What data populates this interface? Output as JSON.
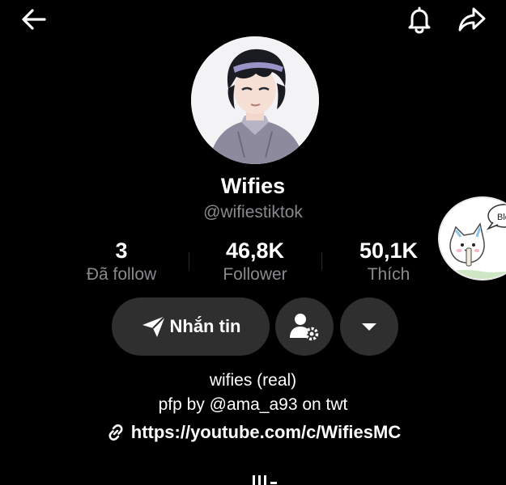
{
  "profile": {
    "display_name": "Wifies",
    "username": "@wifiestiktok"
  },
  "stats": {
    "following": {
      "value": "3",
      "label": "Đã follow"
    },
    "followers": {
      "value": "46,8K",
      "label": "Follower"
    },
    "likes": {
      "value": "50,1K",
      "label": "Thích"
    }
  },
  "actions": {
    "message_label": "Nhắn tin"
  },
  "bio": {
    "line1": "wifies (real)",
    "line2": "pfp by @ama_a93 on twt",
    "link": "https://youtube.com/c/WifiesMC"
  },
  "side_avatar": {
    "speech_text": "Ble"
  },
  "icons": {
    "back": "back-arrow-icon",
    "notifications": "bell-icon",
    "share": "share-arrow-icon",
    "send": "send-icon",
    "add_friend": "user-settings-icon",
    "more": "caret-down-icon",
    "link": "link-icon"
  },
  "colors": {
    "background": "#000000",
    "text_primary": "#ffffff",
    "text_secondary": "#8a8a8e",
    "button_bg": "#2f2f2f"
  }
}
